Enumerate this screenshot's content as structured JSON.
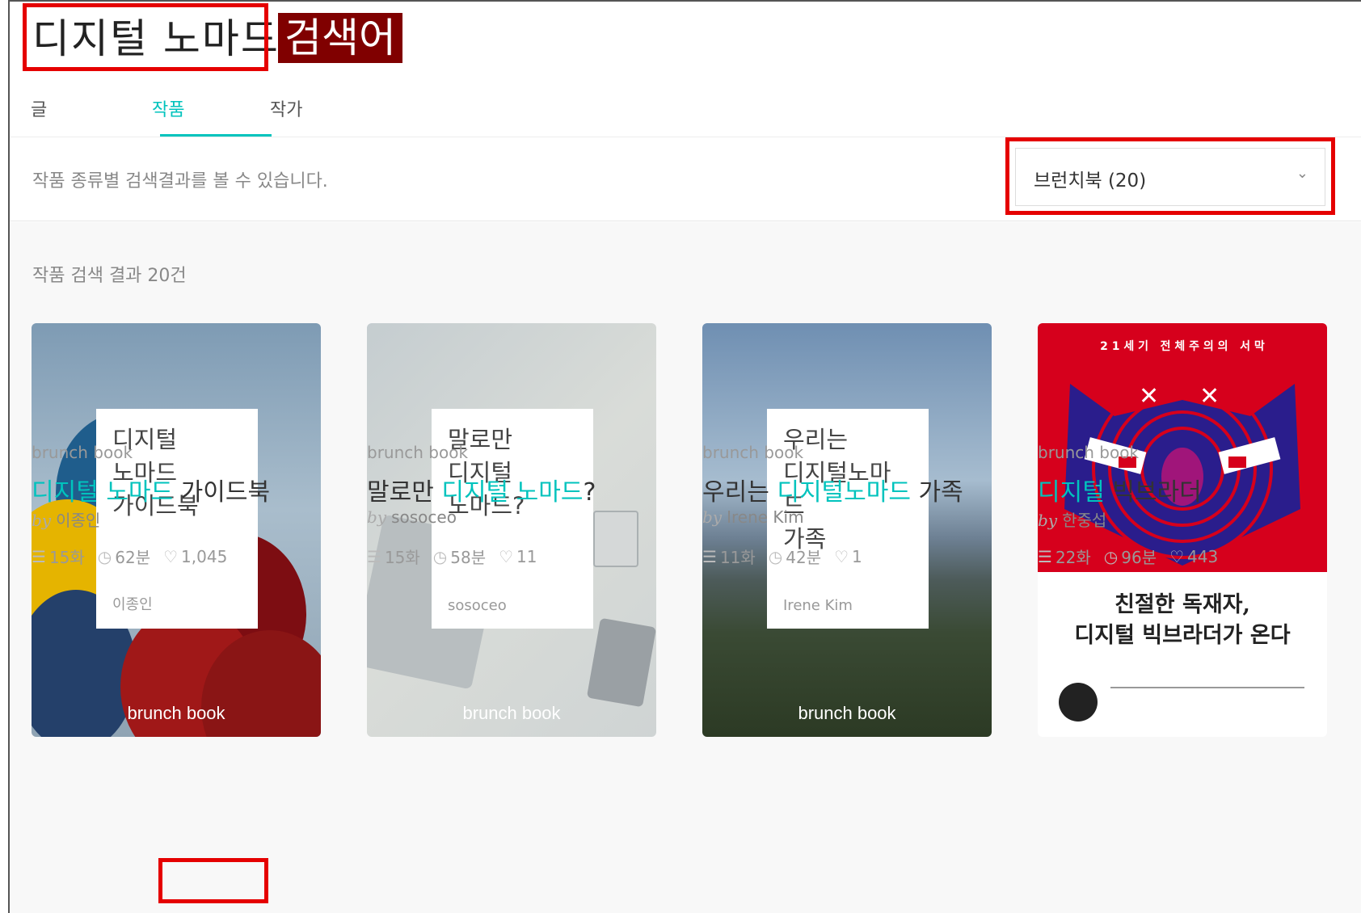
{
  "search": {
    "query": "디지털 노마드",
    "annotation_label": "검색어"
  },
  "tabs": [
    {
      "label": "글",
      "active": false
    },
    {
      "label": "작품",
      "active": true
    },
    {
      "label": "작가",
      "active": false
    }
  ],
  "filter": {
    "description": "작품 종류별 검색결과를 볼 수 있습니다.",
    "selected": "브런치북 (20)"
  },
  "results": {
    "count_label": "작품 검색 결과 20건",
    "cards": [
      {
        "category": "brunch book",
        "title_parts": [
          "디지털 노마드",
          " 가이드북"
        ],
        "cover_title": "디지털\n노마드\n가이드북",
        "cover_author": "이종인",
        "cover_label": "brunch book",
        "by": "by",
        "author": "이종인",
        "episodes": "15화",
        "minutes": "62분",
        "likes": "1,045"
      },
      {
        "category": "brunch book",
        "title_parts": [
          "말로만 ",
          "디지털 노마드",
          "?"
        ],
        "cover_title": "말로만\n디지털\n노마드?",
        "cover_author": "sosoceo",
        "cover_label": "brunch book",
        "by": "by",
        "author": "sosoceo",
        "episodes": "15화",
        "minutes": "58분",
        "likes": "11"
      },
      {
        "category": "brunch book",
        "title_parts": [
          "우리는 ",
          "디지털노마드",
          " 가족"
        ],
        "cover_title": "우리는\n디지털노마드\n가족",
        "cover_author": "Irene Kim",
        "cover_label": "brunch book",
        "by": "by",
        "author": "Irene Kim",
        "episodes": "11화",
        "minutes": "42분",
        "likes": "1"
      },
      {
        "category": "brunch book",
        "title_parts": [
          "디지털",
          " 빅브라더"
        ],
        "cover_top_text": "2 1 세 기   전 체 주 의 의   서 막",
        "cover_big_text": "친절한 독재자,\n디지털 빅브라더가 온다",
        "by": "by",
        "author": "한중섭",
        "episodes": "22화",
        "minutes": "96분",
        "likes": "443"
      }
    ]
  },
  "icons": {
    "episodes": "list-icon",
    "minutes": "clock-icon",
    "likes": "heart-icon"
  },
  "colors": {
    "accent": "#00c3bd",
    "annotation_red": "#e50000",
    "annotation_tag": "#800000"
  }
}
